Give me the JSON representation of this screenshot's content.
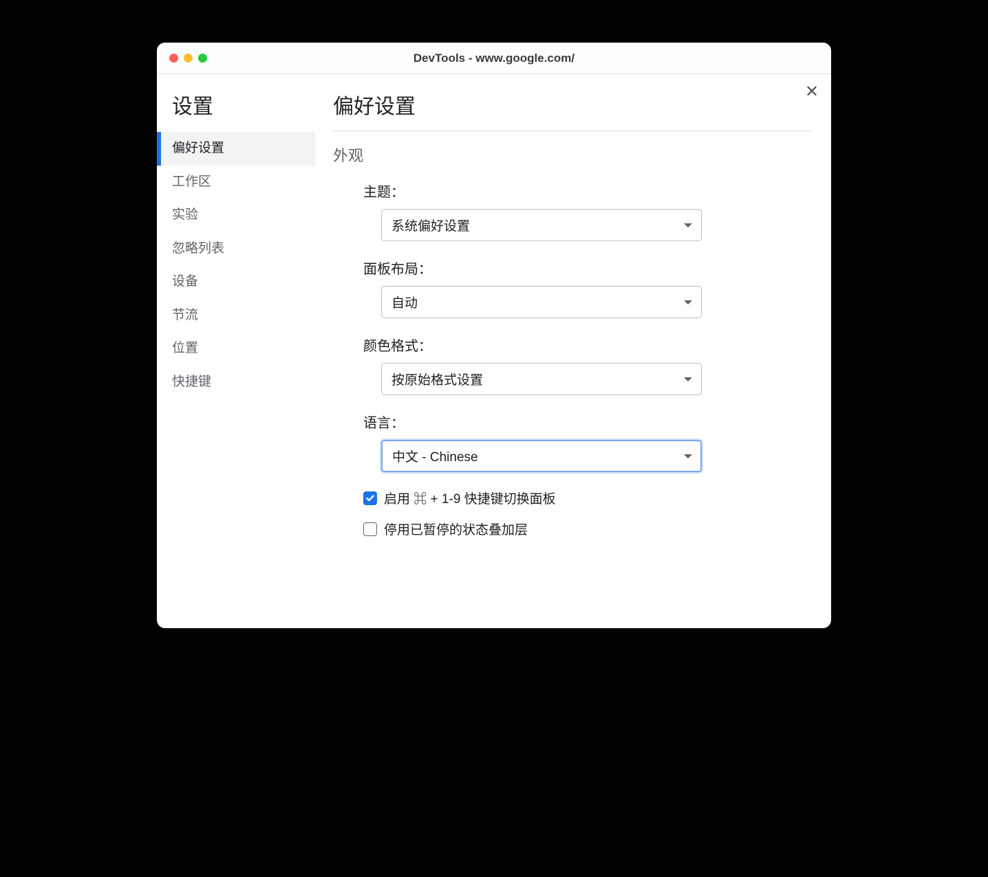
{
  "window": {
    "title": "DevTools - www.google.com/"
  },
  "sidebar": {
    "title": "设置",
    "items": [
      {
        "label": "偏好设置",
        "active": true
      },
      {
        "label": "工作区",
        "active": false
      },
      {
        "label": "实验",
        "active": false
      },
      {
        "label": "忽略列表",
        "active": false
      },
      {
        "label": "设备",
        "active": false
      },
      {
        "label": "节流",
        "active": false
      },
      {
        "label": "位置",
        "active": false
      },
      {
        "label": "快捷键",
        "active": false
      }
    ]
  },
  "main": {
    "title": "偏好设置",
    "section": "外观",
    "fields": {
      "theme": {
        "label": "主题：",
        "value": "系统偏好设置"
      },
      "panel_layout": {
        "label": "面板布局：",
        "value": "自动"
      },
      "color_format": {
        "label": "颜色格式：",
        "value": "按原始格式设置"
      },
      "language": {
        "label": "语言：",
        "value": "中文 - Chinese",
        "focused": true
      }
    },
    "checkboxes": {
      "enable_shortcut": {
        "label": "启用 ⌘ + 1-9 快捷键切换面板",
        "checked": true
      },
      "disable_overlay": {
        "label": "停用已暂停的状态叠加层",
        "checked": false
      }
    }
  }
}
